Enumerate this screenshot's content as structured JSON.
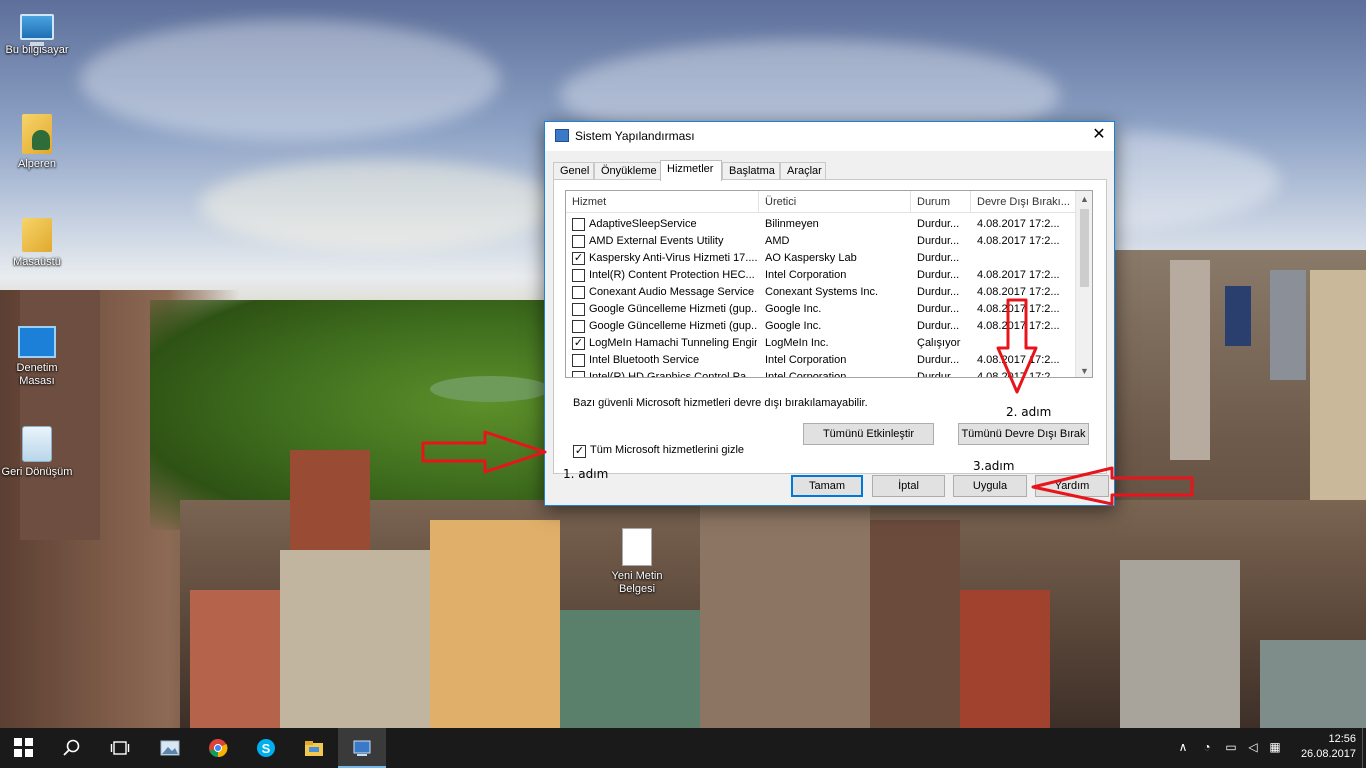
{
  "desktop": {
    "icons": [
      {
        "label": "Bu bilgisayar",
        "icon": "computer-icon"
      },
      {
        "label": "Alperen",
        "icon": "user-folder-icon"
      },
      {
        "label": "Masaüstü",
        "icon": "folder-icon"
      },
      {
        "label": "Denetim Masası",
        "icon": "control-panel-icon"
      },
      {
        "label": "Geri Dönüşüm",
        "icon": "recycle-bin-icon"
      },
      {
        "label": "Yeni Metin Belgesi",
        "icon": "text-document-icon"
      }
    ]
  },
  "dialog": {
    "title": "Sistem Yapılandırması",
    "close_glyph": "✕",
    "tabs": [
      "Genel",
      "Önyükleme",
      "Hizmetler",
      "Başlatma",
      "Araçlar"
    ],
    "active_tab": "Hizmetler",
    "columns": [
      "Hizmet",
      "Üretici",
      "Durum",
      "Devre Dışı Bırakı..."
    ],
    "services": [
      {
        "checked": false,
        "name": "AdaptiveSleepService",
        "maker": "Bilinmeyen",
        "status": "Durdur...",
        "disabled": "4.08.2017 17:2..."
      },
      {
        "checked": false,
        "name": "AMD External Events Utility",
        "maker": "AMD",
        "status": "Durdur...",
        "disabled": "4.08.2017 17:2..."
      },
      {
        "checked": true,
        "name": "Kaspersky Anti-Virus Hizmeti 17....",
        "maker": "AO Kaspersky Lab",
        "status": "Durdur...",
        "disabled": ""
      },
      {
        "checked": false,
        "name": "Intel(R) Content Protection HEC...",
        "maker": "Intel Corporation",
        "status": "Durdur...",
        "disabled": "4.08.2017 17:2..."
      },
      {
        "checked": false,
        "name": "Conexant Audio Message Service",
        "maker": "Conexant Systems Inc.",
        "status": "Durdur...",
        "disabled": "4.08.2017 17:2..."
      },
      {
        "checked": false,
        "name": "Google Güncelleme Hizmeti (gup...",
        "maker": "Google Inc.",
        "status": "Durdur...",
        "disabled": "4.08.2017 17:2..."
      },
      {
        "checked": false,
        "name": "Google Güncelleme Hizmeti (gup...",
        "maker": "Google Inc.",
        "status": "Durdur...",
        "disabled": "4.08.2017 17:2..."
      },
      {
        "checked": true,
        "name": "LogMeIn Hamachi Tunneling Engine",
        "maker": "LogMeIn Inc.",
        "status": "Çalışıyor",
        "disabled": ""
      },
      {
        "checked": false,
        "name": "Intel Bluetooth Service",
        "maker": "Intel Corporation",
        "status": "Durdur...",
        "disabled": "4.08.2017 17:2..."
      },
      {
        "checked": false,
        "name": "Intel(R) HD Graphics Control Pa...",
        "maker": "Intel Corporation",
        "status": "Durdur...",
        "disabled": "4.08.2017 17:2..."
      }
    ],
    "note": "Bazı güvenli Microsoft hizmetleri devre dışı bırakılamayabilir.",
    "enable_all_label": "Tümünü Etkinleştir",
    "disable_all_label": "Tümünü Devre Dışı Bırak",
    "hide_ms_label": "Tüm Microsoft hizmetlerini gizle",
    "hide_ms_checked": true,
    "ok_label": "Tamam",
    "cancel_label": "İptal",
    "apply_label": "Uygula",
    "help_label": "Yardım"
  },
  "annotations": {
    "step1": "1. adım",
    "step2": "2. adım",
    "step3": "3.adım",
    "arrow_color": "#e8141b"
  },
  "taskbar": {
    "apps": [
      "start-icon",
      "search-icon",
      "task-view-icon",
      "image-viewer-icon",
      "chrome-icon",
      "skype-icon",
      "file-explorer-icon",
      "system-config-icon"
    ],
    "time": "12:56",
    "date": "26.08.2017"
  }
}
